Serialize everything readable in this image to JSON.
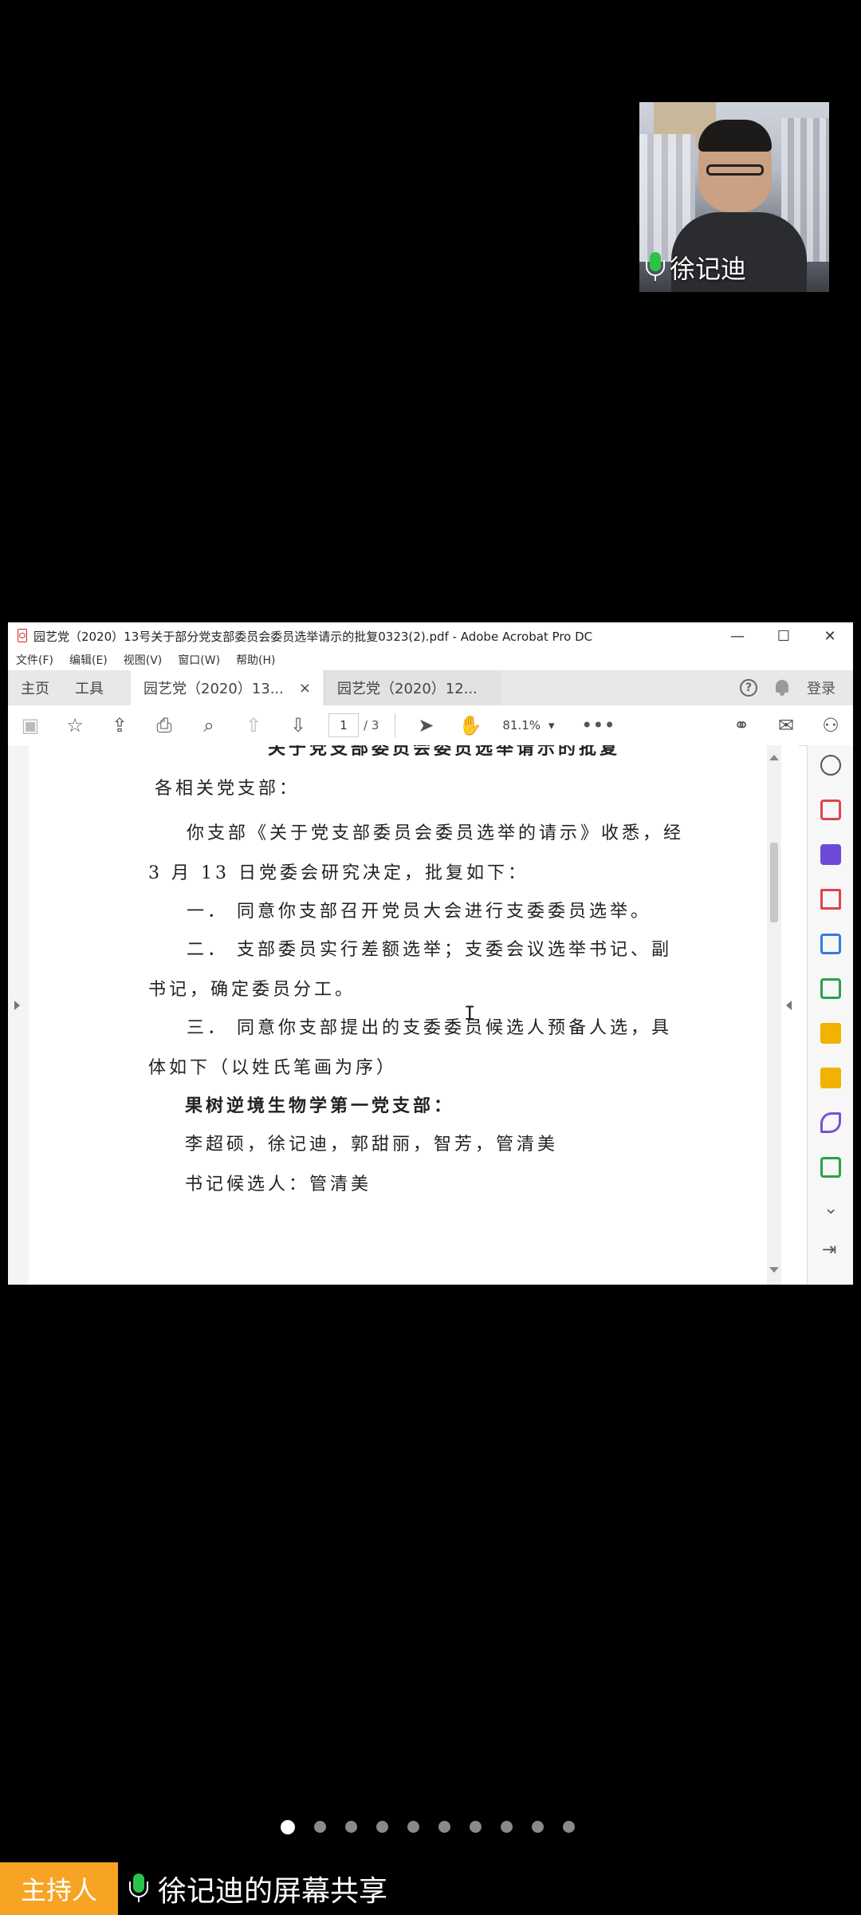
{
  "video": {
    "participant_name": "徐记迪"
  },
  "window": {
    "title": "园艺党（2020）13号关于部分党支部委员会委员选举请示的批复0323(2).pdf - Adobe Acrobat Pro DC",
    "controls": {
      "minimize": "—",
      "maximize": "☐",
      "close": "✕"
    },
    "menu": [
      "文件(F)",
      "编辑(E)",
      "视图(V)",
      "窗口(W)",
      "帮助(H)"
    ],
    "tabs": {
      "home": "主页",
      "tools": "工具",
      "doc1": "园艺党（2020）13...",
      "doc1_close": "×",
      "doc2": "园艺党（2020）12...",
      "login": "登录"
    },
    "toolbar": {
      "current_page": "1",
      "total_pages": "/ 3",
      "zoom": "81.1%",
      "more": "•••"
    },
    "document": {
      "partial_heading": "关于党支部委员会委员选举请示的批复",
      "lines": [
        "各相关党支部：",
        "你支部《关于党支部委员会委员选举的请示》收悉，经",
        "3 月 13 日党委会研究决定，批复如下：",
        "一．  同意你支部召开党员大会进行支委委员选举。",
        "二．  支部委员实行差额选举；支委会议选举书记、副",
        "书记，确定委员分工。",
        "三．  同意你支部提出的支委委员候选人预备人选，具",
        "体如下（以姓氏笔画为序）",
        "果树逆境生物学第一党支部：",
        "李超硕，徐记迪，郭甜丽，智芳，管清美",
        "书记候选人：管清美"
      ]
    }
  },
  "pager": {
    "count": 10,
    "active": 0
  },
  "footer": {
    "host_label": "主持人",
    "share_label": "徐记迪的屏幕共享"
  },
  "colors": {
    "host_badge": "#f7a424",
    "mic_green": "#2bc34a",
    "acrobat_blue": "#1473e6",
    "acrobat_red": "#e0434a"
  }
}
